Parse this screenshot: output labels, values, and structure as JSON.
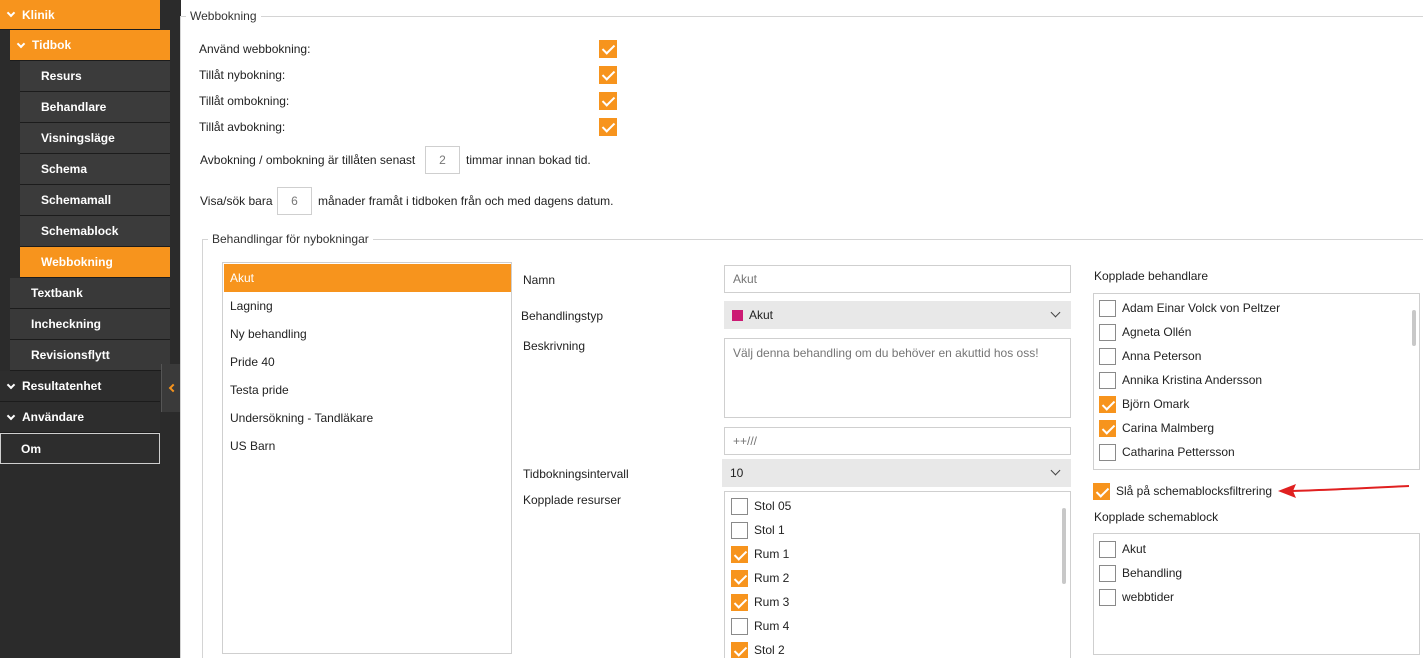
{
  "sidebar": {
    "items": [
      {
        "label": "Klinik",
        "level": 0,
        "expanded": true,
        "selected": true
      },
      {
        "label": "Tidbok",
        "level": 1,
        "expanded": true,
        "selected": true
      },
      {
        "label": "Resurs",
        "level": 2
      },
      {
        "label": "Behandlare",
        "level": 2
      },
      {
        "label": "Visningsläge",
        "level": 2
      },
      {
        "label": "Schema",
        "level": 2
      },
      {
        "label": "Schemamall",
        "level": 2
      },
      {
        "label": "Schemablock",
        "level": 2
      },
      {
        "label": "Webbokning",
        "level": 2,
        "selected": true
      },
      {
        "label": "Textbank",
        "level": 1
      },
      {
        "label": "Incheckning",
        "level": 1
      },
      {
        "label": "Revisionsflytt",
        "level": 1
      },
      {
        "label": "Resultatenhet",
        "level": 0,
        "expanded": true
      },
      {
        "label": "Användare",
        "level": 0,
        "expanded": true
      },
      {
        "label": "Om",
        "level": 0
      }
    ]
  },
  "webbokning": {
    "legend": "Webbokning",
    "options": [
      {
        "label": "Använd webbokning:",
        "checked": true
      },
      {
        "label": "Tillåt nybokning:",
        "checked": true
      },
      {
        "label": "Tillåt ombokning:",
        "checked": true
      },
      {
        "label": "Tillåt avbokning:",
        "checked": true
      }
    ],
    "cancel_prefix": "Avbokning / ombokning är tillåten senast",
    "cancel_hours": "2",
    "cancel_suffix": "timmar innan bokad tid.",
    "months_prefix": "Visa/sök bara",
    "months_value": "6",
    "months_suffix": "månader framåt i tidboken från och med dagens datum."
  },
  "treatments": {
    "legend": "Behandlingar för nybokningar",
    "list": [
      "Akut",
      "Lagning",
      "Ny behandling",
      "Pride 40",
      "Testa pride",
      "Undersökning - Tandläkare",
      "US Barn"
    ],
    "selected_index": 0,
    "form": {
      "name_label": "Namn",
      "name_placeholder": "Akut",
      "type_label": "Behandlingstyp",
      "type_value": "Akut",
      "type_color": "#cc1a74",
      "desc_label": "Beskrivning",
      "desc_placeholder": "Välj denna behandling om du behöver en akuttid hos oss!",
      "extra_placeholder": "++///",
      "interval_label": "Tidbokningsintervall",
      "interval_value": "10",
      "resources_label": "Kopplade resurser",
      "resources": [
        {
          "label": "Stol 05",
          "checked": false
        },
        {
          "label": "Stol 1",
          "checked": false
        },
        {
          "label": "Rum 1",
          "checked": true
        },
        {
          "label": "Rum 2",
          "checked": true
        },
        {
          "label": "Rum 3",
          "checked": true
        },
        {
          "label": "Rum 4",
          "checked": false
        },
        {
          "label": "Stol 2",
          "checked": true
        }
      ]
    },
    "practitioners_label": "Kopplade behandlare",
    "practitioners": [
      {
        "label": "Adam Einar Volck von Peltzer",
        "checked": false
      },
      {
        "label": "Agneta Ollén",
        "checked": false
      },
      {
        "label": "Anna Peterson",
        "checked": false
      },
      {
        "label": "Annika Kristina Andersson",
        "checked": false
      },
      {
        "label": "Björn Omark",
        "checked": true
      },
      {
        "label": "Carina Malmberg",
        "checked": true
      },
      {
        "label": "Catharina Pettersson",
        "checked": false
      }
    ],
    "filter_label": "Slå på schemablocksfiltrering",
    "filter_checked": true,
    "blocks_label": "Kopplade schemablock",
    "blocks": [
      {
        "label": "Akut",
        "checked": false
      },
      {
        "label": "Behandling",
        "checked": false
      },
      {
        "label": "webbtider",
        "checked": false
      }
    ]
  },
  "colors": {
    "accent": "#f7941d",
    "sidebar_bg": "#2b2b2b",
    "annotation": "#e02020"
  }
}
